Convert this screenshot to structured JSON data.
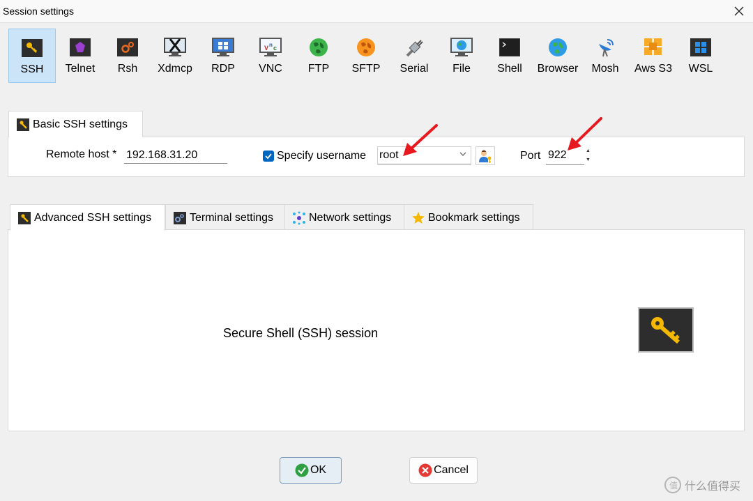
{
  "window": {
    "title": "Session settings"
  },
  "session_types": [
    {
      "label": "SSH",
      "icon": "key-icon",
      "selected": true
    },
    {
      "label": "Telnet",
      "icon": "telnet-icon"
    },
    {
      "label": "Rsh",
      "icon": "rsh-icon"
    },
    {
      "label": "Xdmcp",
      "icon": "xdmcp-icon"
    },
    {
      "label": "RDP",
      "icon": "rdp-icon"
    },
    {
      "label": "VNC",
      "icon": "vnc-icon"
    },
    {
      "label": "FTP",
      "icon": "ftp-icon"
    },
    {
      "label": "SFTP",
      "icon": "sftp-icon"
    },
    {
      "label": "Serial",
      "icon": "serial-icon"
    },
    {
      "label": "File",
      "icon": "file-icon"
    },
    {
      "label": "Shell",
      "icon": "shell-icon"
    },
    {
      "label": "Browser",
      "icon": "browser-icon"
    },
    {
      "label": "Mosh",
      "icon": "mosh-icon"
    },
    {
      "label": "Aws S3",
      "icon": "aws-s3-icon"
    },
    {
      "label": "WSL",
      "icon": "wsl-icon"
    }
  ],
  "basic_tab": {
    "label": "Basic SSH settings"
  },
  "remote_host": {
    "label": "Remote host *",
    "value": "192.168.31.20"
  },
  "specify_username": {
    "label": "Specify username",
    "checked": true,
    "value": "root"
  },
  "port": {
    "label": "Port",
    "value": "922"
  },
  "advanced_tabs": [
    {
      "label": "Advanced SSH settings",
      "icon": "wrench-icon"
    },
    {
      "label": "Terminal settings",
      "icon": "terminal-icon"
    },
    {
      "label": "Network settings",
      "icon": "network-icon"
    },
    {
      "label": "Bookmark settings",
      "icon": "star-icon"
    }
  ],
  "session_description": "Secure Shell (SSH) session",
  "buttons": {
    "ok": "OK",
    "cancel": "Cancel"
  },
  "watermark": "什么值得买",
  "colors": {
    "selected_bg": "#cce4f7",
    "checkbox": "#0067c0",
    "ok": "#2ea043",
    "cancel": "#e53935",
    "arrow": "#e8191e",
    "key": "#f5b800"
  }
}
